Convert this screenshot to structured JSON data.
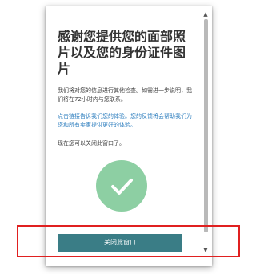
{
  "dialog": {
    "title": "感谢您提供您的面部照片以及您的身份证件图片",
    "paragraph_1": "我们将对您的信息进行其他检查。如需进一步说明，我们将在72小时内与您联系。",
    "paragraph_2": "点击链接告诉我们您的体验。您的反馈将会帮助我们为您和所有卖家提供更好的体验。",
    "paragraph_3": "现在您可以关闭此窗口了。",
    "close_button_label": "关闭此窗口",
    "status_icon": "check-circle-icon"
  },
  "colors": {
    "button": "#3a7d86",
    "link_text": "#2f7fbf",
    "check_circle": "#8dcfa3",
    "highlight": "#e02020"
  }
}
